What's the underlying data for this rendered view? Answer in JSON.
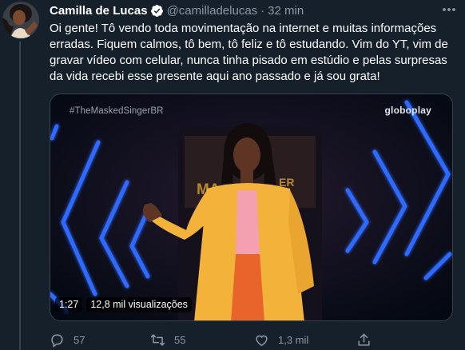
{
  "tweet": {
    "author_name": "Camilla de Lucas",
    "handle": "@camilladelucas",
    "separator": "·",
    "time": "32 min",
    "text": "Oi gente! Tô vendo toda movimentação na internet e muitas informações erradas. Fiquem calmos, tô bem, tô feliz e tô estudando. Vim do YT, vim de gravar vídeo com celular, nunca tinha pisado em estúdio e pelas surpresas da vida recebi esse presente aqui ano passado e já sou grata!"
  },
  "video": {
    "hashtag": "#TheMaskedSingerBR",
    "watermark": "globoplay",
    "duration": "1:27",
    "views": "12,8 mil visualizações"
  },
  "actions": {
    "replies": "57",
    "retweets": "55",
    "likes": "1,3 mil"
  },
  "colors": {
    "background": "#15202b",
    "secondary_text": "#8b98a5",
    "verified_badge": "#ffffff",
    "neon_blue": "#2f6bff"
  },
  "icons": [
    "verified-badge-icon",
    "more-options-icon",
    "reply-icon",
    "retweet-icon",
    "like-icon",
    "share-icon"
  ]
}
